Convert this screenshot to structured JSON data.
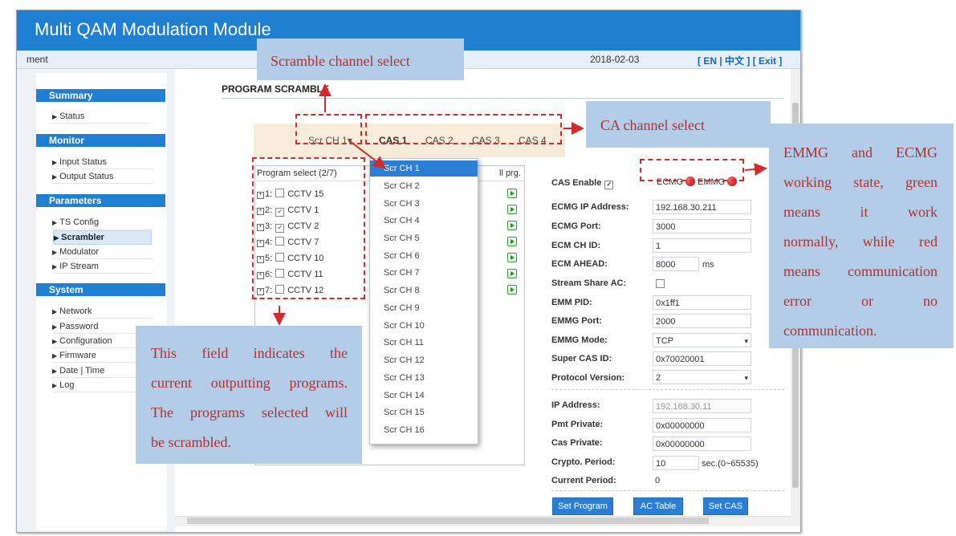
{
  "window": {
    "title": "Multi QAM Modulation Module"
  },
  "subbar": {
    "left_text": "ment",
    "date": "2018-02-03",
    "lang_text": "[ EN | 中文 ]  [ Exit ]"
  },
  "sidebar": {
    "sections": [
      {
        "title": "Summary",
        "items": [
          "Status"
        ]
      },
      {
        "title": "Monitor",
        "items": [
          "Input Status",
          "Output Status"
        ]
      },
      {
        "title": "Parameters",
        "items": [
          "TS Config",
          "Scrambler",
          "Modulator",
          "IP Stream"
        ]
      },
      {
        "title": "System",
        "items": [
          "Network",
          "Password",
          "Configuration",
          "Firmware",
          "Date | Time",
          "Log"
        ]
      }
    ],
    "active": "Scrambler"
  },
  "page": {
    "title": "PROGRAM SCRAMBLE"
  },
  "tabs": {
    "scr_label": "Scr CH 1",
    "cas": [
      "CAS 1",
      "CAS 2",
      "CAS 3",
      "CAS 4"
    ],
    "active": "CAS 1"
  },
  "program_select": {
    "header": "Program select (2/7)",
    "header_right": "ll prg.",
    "rows": [
      {
        "num": "1:",
        "name": "CCTV 15",
        "checked": false
      },
      {
        "num": "2:",
        "name": "CCTV 1",
        "checked": true
      },
      {
        "num": "3:",
        "name": "CCTV 2",
        "checked": true
      },
      {
        "num": "4:",
        "name": "CCTV 7",
        "checked": false
      },
      {
        "num": "5:",
        "name": "CCTV 10",
        "checked": false
      },
      {
        "num": "6:",
        "name": "CCTV 11",
        "checked": false
      },
      {
        "num": "7:",
        "name": "CCTV 12",
        "checked": false
      }
    ]
  },
  "dropdown": {
    "selected": "Scr CH 1",
    "options": [
      "Scr CH 1",
      "Scr CH 2",
      "Scr CH 3",
      "Scr CH 4",
      "Scr CH 5",
      "Scr CH 6",
      "Scr CH 7",
      "Scr CH 8",
      "Scr CH 9",
      "Scr CH 10",
      "Scr CH 11",
      "Scr CH 12",
      "Scr CH 13",
      "Scr CH 14",
      "Scr CH 15",
      "Scr CH 16"
    ]
  },
  "cas_form": {
    "cas_enable_label": "CAS Enable",
    "ecmg_label": "ECMG",
    "emmg_label": "EMMG",
    "status_color": "#cc0000",
    "fields": {
      "ecmg_ip_label": "ECMG IP Address:",
      "ecmg_ip": "192.168.30.211",
      "ecmg_port_label": "ECMG Port:",
      "ecmg_port": "3000",
      "ecm_ch_id_label": "ECM CH ID:",
      "ecm_ch_id": "1",
      "ecm_ahead_label": "ECM AHEAD:",
      "ecm_ahead": "8000",
      "ecm_ahead_unit": "ms",
      "stream_share_label": "Stream Share AC:",
      "emm_pid_label": "EMM PID:",
      "emm_pid": "0x1ff1",
      "emmg_port_label": "EMMG Port:",
      "emmg_port": "2000",
      "emmg_mode_label": "EMMG Mode:",
      "emmg_mode": "TCP",
      "super_cas_label": "Super CAS ID:",
      "super_cas": "0x70020001",
      "protocol_label": "Protocol Version:",
      "protocol": "2",
      "ip_label": "IP Address:",
      "ip": "192.168.30.11",
      "pmt_label": "Pmt Private:",
      "pmt": "0x00000000",
      "cas_private_label": "Cas Private:",
      "cas_private": "0x00000000",
      "crypto_label": "Crypto. Period:",
      "crypto": "10",
      "crypto_unit": "sec.(0~65535)",
      "current_label": "Current Period:",
      "current": "0"
    },
    "buttons": {
      "set_program": "Set Program",
      "ac_table": "AC Table",
      "set_cas": "Set CAS"
    }
  },
  "annotations": {
    "scramble_channel": "Scramble channel select",
    "ca_channel": "CA channel select",
    "emmg_lines": [
      "EMMG and ECMG",
      "working state, green",
      "means it work",
      "normally, while red",
      "means communication",
      "error or no",
      "communication."
    ],
    "field_lines": [
      "This field indicates the",
      "current outputting programs.",
      "The programs selected will",
      "be scrambled."
    ]
  },
  "colors": {
    "header_blue": "#1f7fd0",
    "accent_red": "#d12b2b",
    "callout_bg": "#b3cde9"
  }
}
